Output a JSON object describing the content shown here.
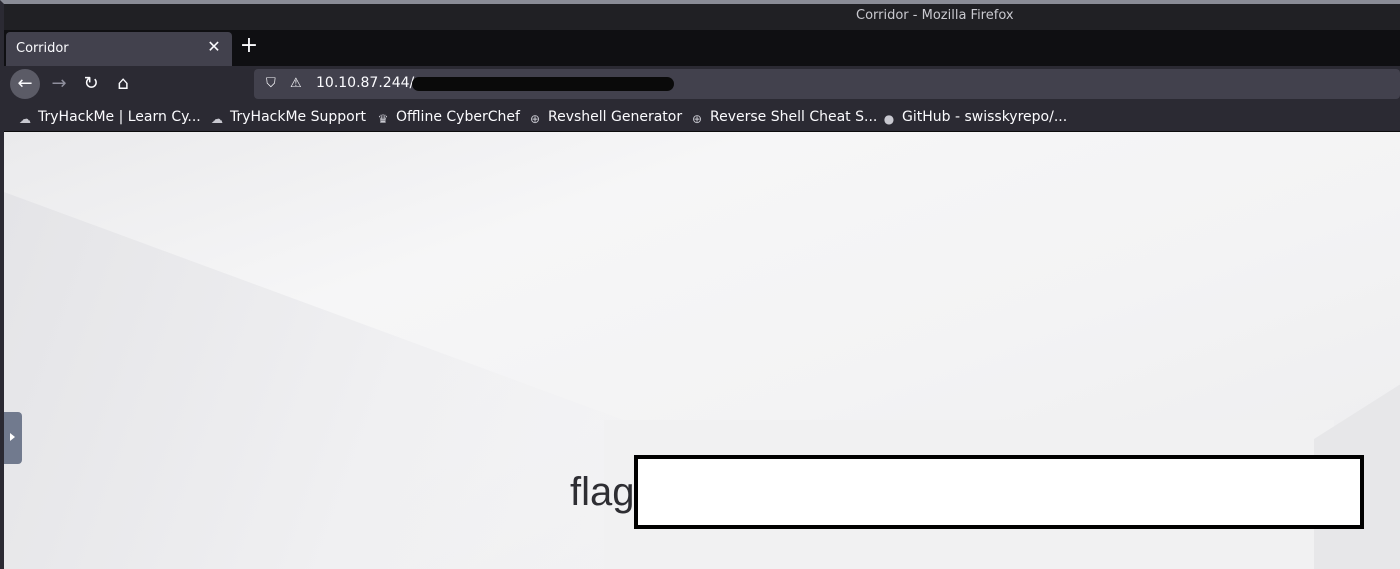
{
  "window": {
    "title": "Corridor - Mozilla Firefox"
  },
  "tabs": [
    {
      "label": "Corridor",
      "close_icon": "close-icon"
    }
  ],
  "newtab": {
    "symbol": "+"
  },
  "nav": {
    "back_icon": "←",
    "forward_icon": "→",
    "reload_icon": "↻",
    "home_icon": "⌂",
    "url": "10.10.87.244/",
    "url_redacted": true
  },
  "bookmarks": [
    {
      "label": "TryHackMe | Learn Cy...",
      "icon": "tryhackme-icon",
      "glyph": "☁"
    },
    {
      "label": "TryHackMe Support",
      "icon": "tryhackme-icon",
      "glyph": "☁"
    },
    {
      "label": "Offline CyberChef",
      "icon": "chef-icon",
      "glyph": "♛"
    },
    {
      "label": "Revshell Generator",
      "icon": "globe-icon",
      "glyph": "⊕"
    },
    {
      "label": "Reverse Shell Cheat S...",
      "icon": "globe-icon",
      "glyph": "⊕"
    },
    {
      "label": "GitHub - swisskyrepo/...",
      "icon": "github-icon",
      "glyph": "●"
    }
  ],
  "page": {
    "flag_label": "flag",
    "flag_value": ""
  },
  "colors": {
    "toolbar": "#2b2a33",
    "tabstrip": "#0f0f12",
    "tab_active": "#42414d",
    "handle": "#717a8e"
  }
}
